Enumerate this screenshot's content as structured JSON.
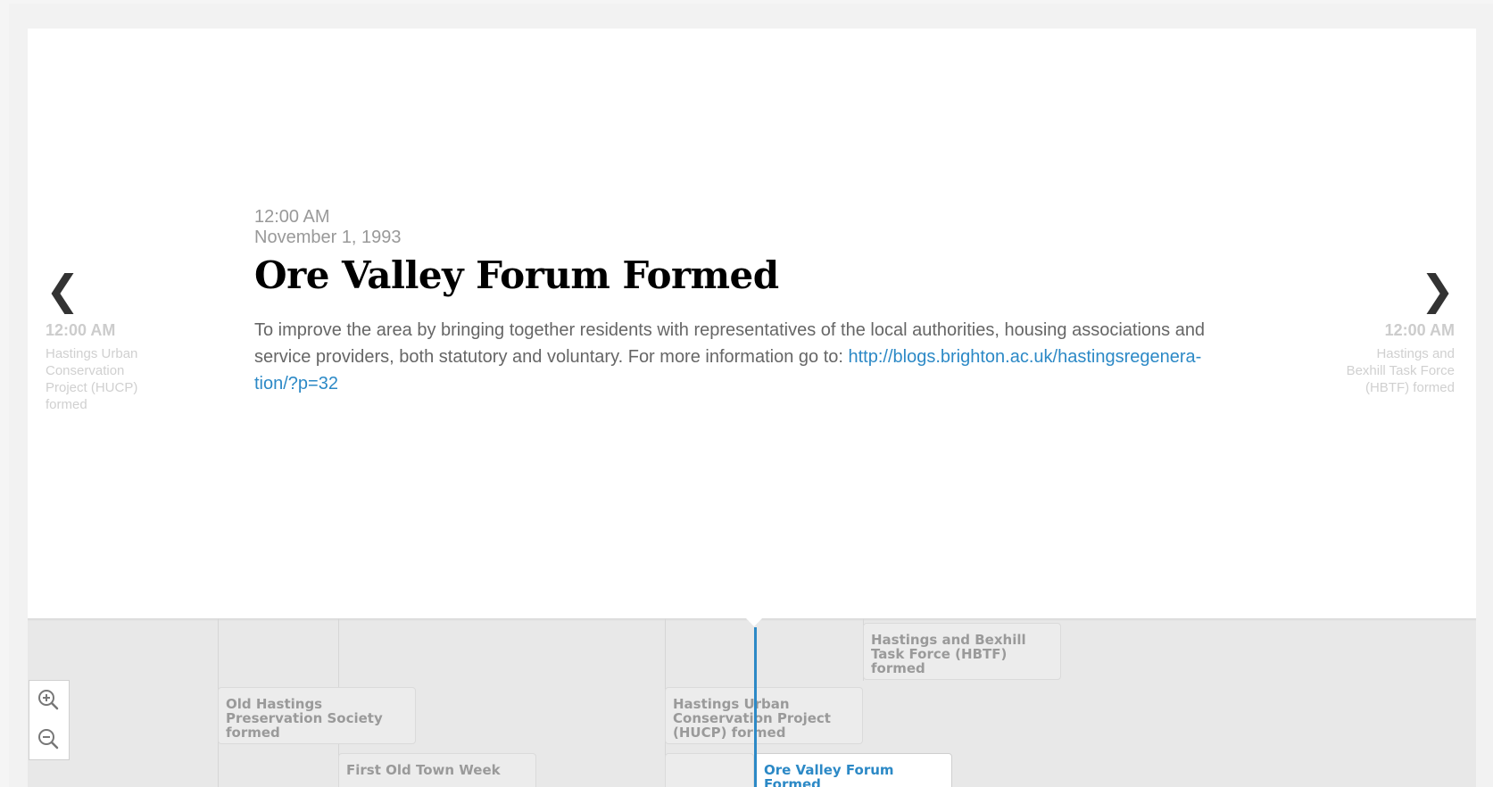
{
  "slide": {
    "time": "12:00 AM",
    "date": "November 1, 1993",
    "headline": "Ore Valley Forum Formed",
    "text": "To improve the area by bringing together residents with representatives of the local authorities, housing associations and service providers, both statutory and voluntary. For more information go to: ",
    "link_text": "http://blogs.brighton.ac.uk/hastingsregenera­tion/?p=32"
  },
  "nav_prev": {
    "icon": "chevron-left-icon",
    "glyph": "❮",
    "time": "12:00 AM",
    "title": "Hastings Urban Conservation Project (HUCP) formed"
  },
  "nav_next": {
    "icon": "chevron-right-icon",
    "glyph": "❯",
    "time": "12:00 AM",
    "title": "Hastings and Bexhill Task Force (HBTF) formed"
  },
  "timeline": {
    "markers": [
      "Hastings and Bexhill Task Force (HBTF) formed",
      "Old Hastings Preservation Society formed",
      "Hastings Urban Conservation Project (HUCP) formed",
      "First Old Town Week",
      "Ore Valley Forum Formed"
    ]
  },
  "zoom": {
    "in_icon": "zoom-in-icon",
    "out_icon": "zoom-out-icon"
  },
  "colors": {
    "accent": "#2c89c6",
    "headline": "#000000",
    "muted": "#999999"
  }
}
